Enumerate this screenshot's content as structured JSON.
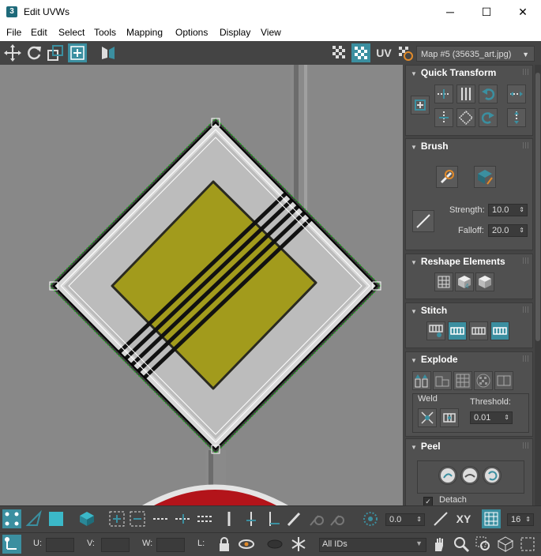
{
  "window": {
    "app_icon": "3",
    "title": "Edit UVWs",
    "minimize": "─",
    "maximize": "☐",
    "close": "✕"
  },
  "menu": [
    "File",
    "Edit",
    "Select",
    "Tools",
    "Mapping",
    "Options",
    "Display",
    "View"
  ],
  "toolbar": {
    "uv_label": "UV",
    "map_dropdown": "Map #5 (35635_art.jpg)"
  },
  "panel": {
    "quick_transform": {
      "title": "Quick Transform"
    },
    "brush": {
      "title": "Brush",
      "strength_label": "Strength:",
      "strength_value": "10.0",
      "falloff_label": "Falloff:",
      "falloff_value": "20.0"
    },
    "reshape_elements": {
      "title": "Reshape Elements"
    },
    "stitch": {
      "title": "Stitch"
    },
    "explode": {
      "title": "Explode",
      "weld_label": "Weld",
      "threshold_label": "Threshold:",
      "threshold_value": "0.01"
    },
    "peel": {
      "title": "Peel",
      "detach_label": "Detach",
      "detach_checked": true
    }
  },
  "bottom": {
    "rotate_value": "0.0",
    "xy_label": "XY",
    "grid_value": "16",
    "u_label": "U:",
    "v_label": "V:",
    "w_label": "W:",
    "l_label": "L:",
    "ids_dropdown": "All IDs"
  },
  "colors": {
    "accent": "#3b8fa0",
    "sign_yellow": "#a29b1c",
    "viewport_bg": "#888888",
    "selection_green": "#2aa82a"
  }
}
